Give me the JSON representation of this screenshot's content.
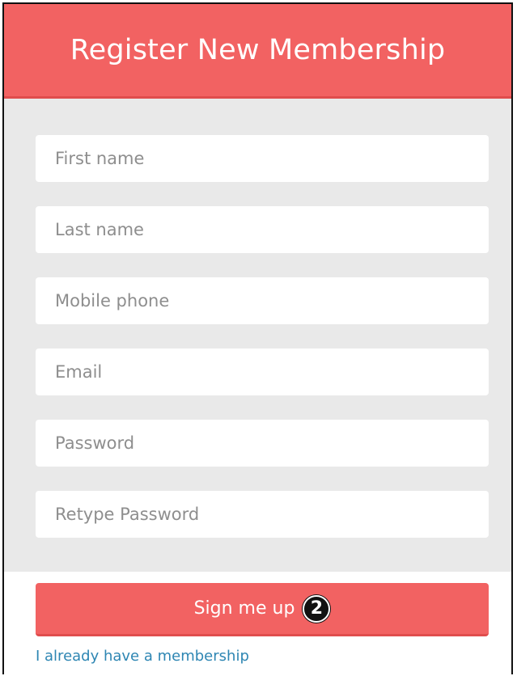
{
  "header": {
    "title": "Register New Membership"
  },
  "form": {
    "fields": [
      {
        "placeholder": "First name",
        "value": ""
      },
      {
        "placeholder": "Last name",
        "value": ""
      },
      {
        "placeholder": "Mobile phone",
        "value": ""
      },
      {
        "placeholder": "Email",
        "value": ""
      },
      {
        "placeholder": "Password",
        "value": ""
      },
      {
        "placeholder": "Retype Password",
        "value": ""
      }
    ],
    "submit_label": "Sign me up",
    "step_badge": "2",
    "login_link": "I already have a membership"
  },
  "colors": {
    "accent": "#f26262",
    "form_background": "#e9e9e9",
    "link": "#2e86b3"
  }
}
